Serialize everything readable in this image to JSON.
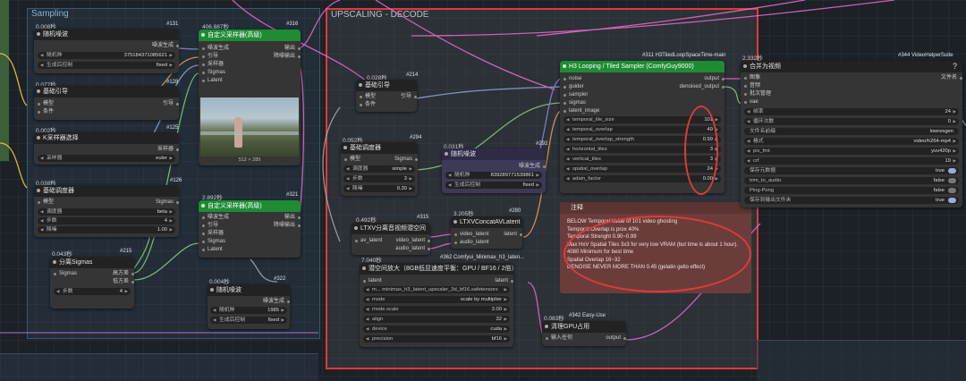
{
  "groups": {
    "sampling": "Sampling",
    "upscaling": "UPSCALING - DECODE"
  },
  "nodes": {
    "n131": {
      "time": "0.008秒",
      "id": "#131",
      "title": "随机噪波",
      "out": "噪波生成",
      "w": [
        {
          "l": "随机种",
          "v": "375184371085621"
        },
        {
          "l": "生成后控制",
          "v": "fixed"
        }
      ]
    },
    "n128": {
      "time": "0.077秒",
      "id": "#128",
      "title": "基础引导",
      "in": [
        "模型",
        "条件"
      ],
      "out": "引导"
    },
    "n125": {
      "time": "0.002秒",
      "id": "#125",
      "title": "K采样器选择",
      "out": "采样器",
      "w": [
        {
          "l": "采样器",
          "v": "euler"
        }
      ]
    },
    "n126": {
      "time": "0.038秒",
      "id": "#126",
      "title": "基础调度器",
      "in": [
        "模型"
      ],
      "out": "Sigmas",
      "w": [
        {
          "l": "调度器",
          "v": "beta"
        },
        {
          "l": "步数",
          "v": "4"
        },
        {
          "l": "降噪",
          "v": "1.00"
        }
      ]
    },
    "n215": {
      "time": "0.043秒",
      "id": "#215",
      "title": "分离Sigmas",
      "in": [
        "Sigmas"
      ],
      "out": [
        "高方差",
        "低方差"
      ],
      "w": [
        {
          "l": "步数",
          "v": "4"
        }
      ]
    },
    "n316": {
      "time": "406.887秒",
      "id": "#316",
      "title": "自定义采样器(高级)",
      "in": [
        "噪波生成",
        "引导",
        "采样器",
        "Sigmas",
        "Latent"
      ],
      "out": [
        "输出",
        "降噪输出"
      ],
      "caption": "512 × 289"
    },
    "n321": {
      "time": "2.892秒",
      "id": "#321",
      "title": "自定义采样器(高级)",
      "in": [
        "噪波生成",
        "引导",
        "采样器",
        "Sigmas",
        "Latent"
      ],
      "out": [
        "输出",
        "降噪输出"
      ]
    },
    "n322": {
      "time": "0.004秒",
      "id": "#322",
      "title": "随机噪波",
      "out": "噪波生成",
      "w": [
        {
          "l": "随机种",
          "v": "1985"
        },
        {
          "l": "生成后控制",
          "v": "fixed"
        }
      ]
    },
    "n214": {
      "time": "0.028秒",
      "id": "#214",
      "title": "基础引导",
      "in": [
        "模型",
        "条件"
      ],
      "out": "引导"
    },
    "n294": {
      "time": "0.052秒",
      "id": "#294",
      "title": "基础调度器",
      "in": [
        "模型"
      ],
      "out": "Sigmas",
      "w": [
        {
          "l": "调度器",
          "v": "simple"
        },
        {
          "l": "步数",
          "v": "3"
        },
        {
          "l": "降噪",
          "v": "0.30"
        }
      ]
    },
    "n292": {
      "time": "0.031秒",
      "id": "#292",
      "title": "随机噪波",
      "out": "噪波生成",
      "w": [
        {
          "l": "随机种",
          "v": "839289771539861"
        },
        {
          "l": "生成后控制",
          "v": "fixed"
        }
      ]
    },
    "n315": {
      "time": "0.492秒",
      "id": "#315",
      "title": "LTXV分离音视频潜空间",
      "in": [
        "av_latent"
      ],
      "out": [
        "video_latent",
        "audio_latent"
      ]
    },
    "n280": {
      "time": "3.205秒",
      "id": "#280",
      "title": "LTXVConcatAVLatent",
      "in": [
        "video_latent",
        "audio_latent"
      ],
      "out": "latent"
    },
    "n362": {
      "time": "7.040秒",
      "id": "#362 Comfyui_Minimax_h3_laten...",
      "title": "潜空间放大（8GB低显速度平衡：GPU / BF16 / 2倍）",
      "in": [
        "latent"
      ],
      "out": "latent",
      "w": [
        {
          "l": "m... minimax_h3_latent_upscaler_3d_bf16.safetensors",
          "v": ""
        },
        {
          "l": "mode",
          "v": "scale by multiplier"
        },
        {
          "l": "mode.scale",
          "v": "2.00"
        },
        {
          "l": "align",
          "v": "32"
        },
        {
          "l": "device",
          "v": "cuda"
        },
        {
          "l": "precision",
          "v": "bf16"
        }
      ]
    },
    "n342": {
      "time": "0.083秒",
      "id": "#342 Easy-Use",
      "title": "清理GPU占用",
      "in": [
        "输入任何"
      ],
      "out": "output"
    },
    "n311": {
      "id": "#311 H3TiledLoopSpaceTime-main",
      "title": "H3 Looping / Tiled Sampler (ComfyGuy9000)",
      "in": [
        "noise",
        "guider",
        "sampler",
        "sigmas",
        "latent_image"
      ],
      "out": [
        "output",
        "denoised_output"
      ],
      "w": [
        {
          "l": "temporal_tile_size",
          "v": "101"
        },
        {
          "l": "temporal_overlap",
          "v": "49"
        },
        {
          "l": "temporal_overlap_strength",
          "v": "0.99"
        },
        {
          "l": "horizontal_tiles",
          "v": "3"
        },
        {
          "l": "vertical_tiles",
          "v": "3"
        },
        {
          "l": "spatial_overlap",
          "v": "24"
        },
        {
          "l": "adain_factor",
          "v": "0.00"
        }
      ]
    },
    "n344": {
      "time": "2.332秒",
      "id": "#344 VideoHelperSuite",
      "title": "合并为视频",
      "help": "?",
      "in": [
        "图像",
        "音频",
        "批次管理",
        "vae"
      ],
      "out": "文件名",
      "w": [
        {
          "l": "帧率",
          "v": "24"
        },
        {
          "l": "循环次数",
          "v": "0"
        },
        {
          "l": "文件名前缀",
          "v": "lowresgen"
        },
        {
          "l": "格式",
          "v": "video/h264-mp4"
        },
        {
          "l": "pix_fmt",
          "v": "yuv420p"
        },
        {
          "l": "crf",
          "v": "19"
        },
        {
          "l": "保存元数据",
          "v": "true"
        },
        {
          "l": "trim_to_audio",
          "v": "false"
        },
        {
          "l": "Ping-Pong",
          "v": "false"
        },
        {
          "l": "保存到输出文件夹",
          "v": "true"
        }
      ]
    }
  },
  "note": {
    "title": "注释",
    "text": "BELOW Temporal Value of 101 video ghosting\nTemporal Overlap is prox 40%\nTemporal Strenght 0.90~0.99\nMax HxV Spatial Tiles 3x3 for very low VRAM (but time is about 1 hour).\n4080 Minimum for best time\nSpatial Overlap 16~32\nDENOISE NEVER MORE THAN 0.45 (gelatin gello effect)"
  },
  "colors": {
    "canvas": "#1c2127",
    "group_sampling": "#2d3f52",
    "group_upscale": "#31373e",
    "node_green": "#1e8c33",
    "highlight_red": "#e03a3a",
    "note": "#6b3d3a"
  }
}
